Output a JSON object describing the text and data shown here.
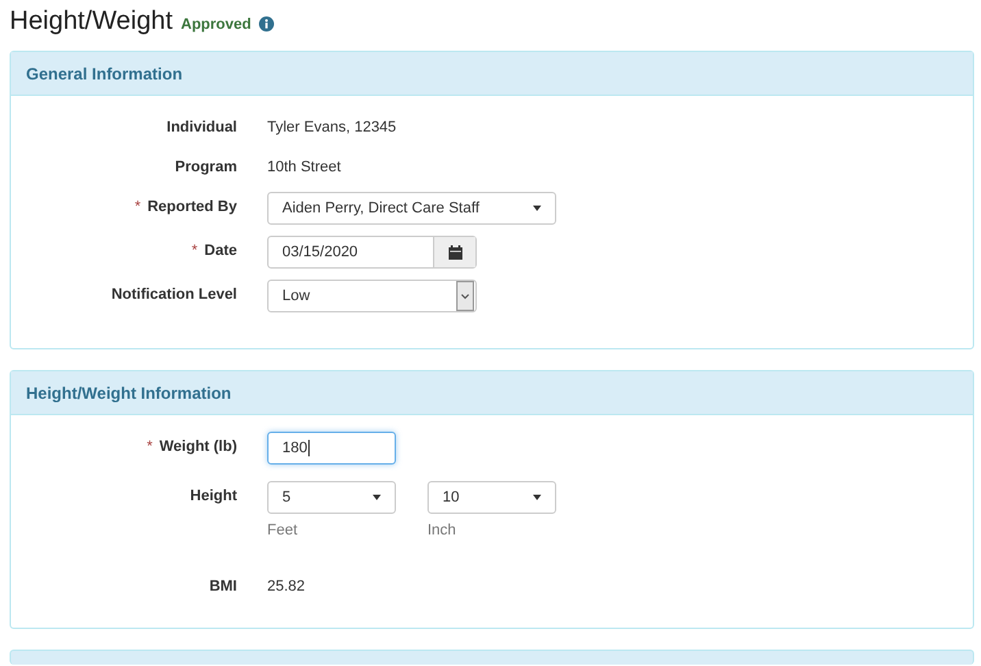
{
  "page": {
    "title": "Height/Weight",
    "status": "Approved"
  },
  "panels": [
    {
      "title": "General Information",
      "fields": [
        {
          "kind": "static",
          "label": "Individual",
          "value": "Tyler Evans, 12345"
        },
        {
          "kind": "static",
          "label": "Program",
          "value": "10th Street"
        },
        {
          "kind": "select",
          "label": "Reported By",
          "required_mark": "*",
          "value": "Aiden Perry, Direct Care Staff"
        },
        {
          "kind": "date",
          "label": "Date",
          "required_mark": "*",
          "value": "03/15/2020"
        },
        {
          "kind": "native-select",
          "label": "Notification Level",
          "value": "Low"
        }
      ]
    },
    {
      "title": "Height/Weight Information",
      "fields": [
        {
          "kind": "input",
          "label": "Weight (lb)",
          "required_mark": "*",
          "value": "180",
          "focused": true
        },
        {
          "kind": "height",
          "label": "Height",
          "parts": [
            {
              "value": "5",
              "hint": "Feet"
            },
            {
              "value": "10",
              "hint": "Inch"
            }
          ]
        },
        {
          "kind": "static",
          "label": "BMI",
          "value": "25.82"
        }
      ]
    }
  ]
}
